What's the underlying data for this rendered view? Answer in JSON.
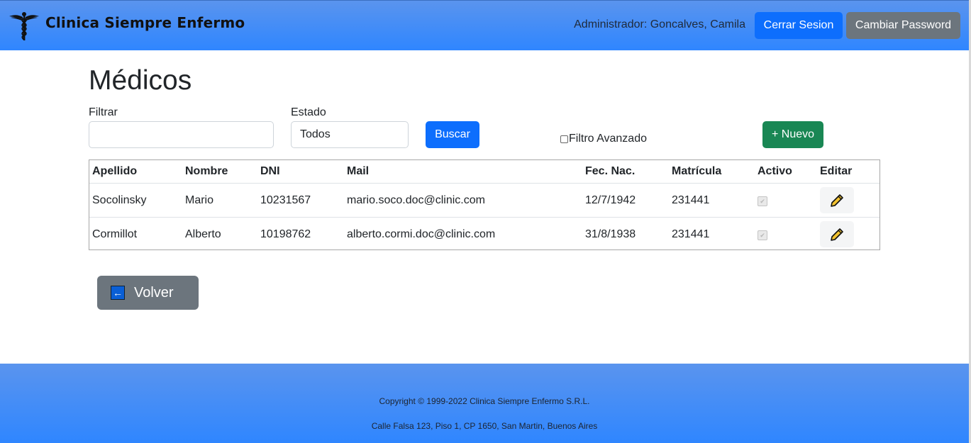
{
  "header": {
    "brand": "Clinica Siempre Enfermo",
    "user_text": "Administrador: Goncalves, Camila",
    "logout_label": "Cerrar Sesion",
    "change_password_label": "Cambiar Password",
    "logo_icon": "caduceus-icon",
    "color_top": "#5a94ee",
    "color_bottom": "#2f86ff"
  },
  "page": {
    "title": "Médicos"
  },
  "filters": {
    "filter_label": "Filtrar",
    "filter_value": "",
    "filter_placeholder": "",
    "status_label": "Estado",
    "status_selected": "Todos",
    "search_label": "Buscar",
    "advanced_label": "Filtro Avanzado",
    "advanced_checked": false,
    "new_label": "+ Nuevo"
  },
  "table": {
    "columns": [
      "Apellido",
      "Nombre",
      "DNI",
      "Mail",
      "Fec. Nac.",
      "Matrícula",
      "Activo",
      "Editar"
    ],
    "rows": [
      {
        "apellido": "Socolinsky",
        "nombre": "Mario",
        "dni": "10231567",
        "mail": "mario.soco.doc@clinic.com",
        "fec_nac": "12/7/1942",
        "matricula": "231441",
        "activo": true,
        "edit_icon": "pencil-icon"
      },
      {
        "apellido": "Cormillot",
        "nombre": "Alberto",
        "dni": "10198762",
        "mail": "alberto.cormi.doc@clinic.com",
        "fec_nac": "31/8/1938",
        "matricula": "231441",
        "activo": true,
        "edit_icon": "pencil-icon"
      }
    ]
  },
  "back": {
    "label": "Volver",
    "icon": "left-arrow-icon"
  },
  "footer": {
    "copyright": "Copyright © 1999-2022 Clinica Siempre Enfermo S.R.L.",
    "address": "Calle Falsa 123, Piso 1, CP 1650, San Martin, Buenos Aires"
  },
  "colors": {
    "primary": "#0d6efd",
    "secondary": "#6c757d",
    "success": "#198754"
  }
}
